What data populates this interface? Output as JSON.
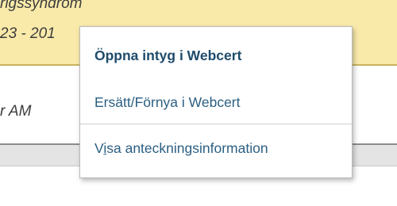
{
  "background": {
    "diagnosis_fragment": "rigssyndrom",
    "date_fragment": "23 - 201",
    "doctor_fragment": "r AM"
  },
  "context_menu": {
    "items": [
      {
        "label": "Öppna intyg i Webcert"
      },
      {
        "label": "Ersätt/Förnya i Webcert"
      },
      {
        "label": "Visa anteckningsinformation",
        "accelerator_prefix": "V",
        "accelerator": "i",
        "accelerator_suffix": "sa anteckningsinformation"
      }
    ]
  }
}
